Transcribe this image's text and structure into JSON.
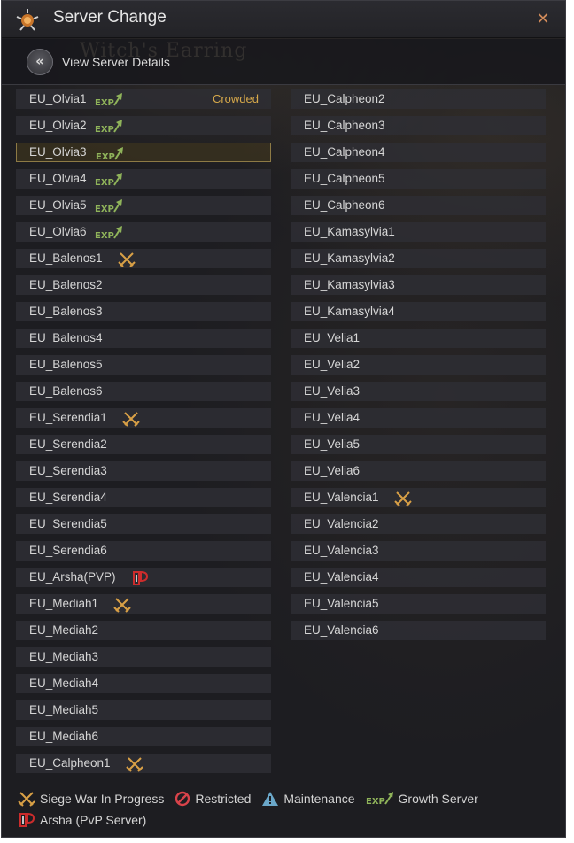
{
  "window": {
    "title": "Server Change",
    "close_symbol": "✕",
    "background_text": "Witch's Earring"
  },
  "toolbar": {
    "details_icon_glyph": "«",
    "details_label": "View Server Details"
  },
  "servers_left": [
    {
      "name": "EU_Olvia1",
      "badge": "exp",
      "status": "Crowded"
    },
    {
      "name": "EU_Olvia2",
      "badge": "exp"
    },
    {
      "name": "EU_Olvia3",
      "badge": "exp",
      "selected": true
    },
    {
      "name": "EU_Olvia4",
      "badge": "exp"
    },
    {
      "name": "EU_Olvia5",
      "badge": "exp"
    },
    {
      "name": "EU_Olvia6",
      "badge": "exp"
    },
    {
      "name": "EU_Balenos1",
      "badge": "siege"
    },
    {
      "name": "EU_Balenos2"
    },
    {
      "name": "EU_Balenos3"
    },
    {
      "name": "EU_Balenos4"
    },
    {
      "name": "EU_Balenos5"
    },
    {
      "name": "EU_Balenos6"
    },
    {
      "name": "EU_Serendia1",
      "badge": "siege"
    },
    {
      "name": "EU_Serendia2"
    },
    {
      "name": "EU_Serendia3"
    },
    {
      "name": "EU_Serendia4"
    },
    {
      "name": "EU_Serendia5"
    },
    {
      "name": "EU_Serendia6"
    },
    {
      "name": "EU_Arsha(PVP)",
      "badge": "pvp"
    },
    {
      "name": "EU_Mediah1",
      "badge": "siege"
    },
    {
      "name": "EU_Mediah2"
    },
    {
      "name": "EU_Mediah3"
    },
    {
      "name": "EU_Mediah4"
    },
    {
      "name": "EU_Mediah5"
    },
    {
      "name": "EU_Mediah6"
    },
    {
      "name": "EU_Calpheon1",
      "badge": "siege"
    }
  ],
  "servers_right": [
    {
      "name": "EU_Calpheon2"
    },
    {
      "name": "EU_Calpheon3"
    },
    {
      "name": "EU_Calpheon4"
    },
    {
      "name": "EU_Calpheon5"
    },
    {
      "name": "EU_Calpheon6"
    },
    {
      "name": "EU_Kamasylvia1"
    },
    {
      "name": "EU_Kamasylvia2"
    },
    {
      "name": "EU_Kamasylvia3"
    },
    {
      "name": "EU_Kamasylvia4"
    },
    {
      "name": "EU_Velia1"
    },
    {
      "name": "EU_Velia2"
    },
    {
      "name": "EU_Velia3"
    },
    {
      "name": "EU_Velia4"
    },
    {
      "name": "EU_Velia5"
    },
    {
      "name": "EU_Velia6"
    },
    {
      "name": "EU_Valencia1",
      "badge": "siege"
    },
    {
      "name": "EU_Valencia2"
    },
    {
      "name": "EU_Valencia3"
    },
    {
      "name": "EU_Valencia4"
    },
    {
      "name": "EU_Valencia5"
    },
    {
      "name": "EU_Valencia6"
    }
  ],
  "badge_text": {
    "exp": "EXP"
  },
  "legend": {
    "siege": "Siege War In Progress",
    "restricted": "Restricted",
    "maintenance": "Maintenance",
    "growth": "Growth Server",
    "pvp": "Arsha (PvP Server)"
  },
  "colors": {
    "accent_gold": "#d6a84a",
    "exp_green": "#8fb35a",
    "siege_orange": "#d9a046",
    "restricted_red": "#d9434a",
    "maintenance_blue": "#6aa7c9",
    "pvp_red": "#cc2c2c"
  }
}
